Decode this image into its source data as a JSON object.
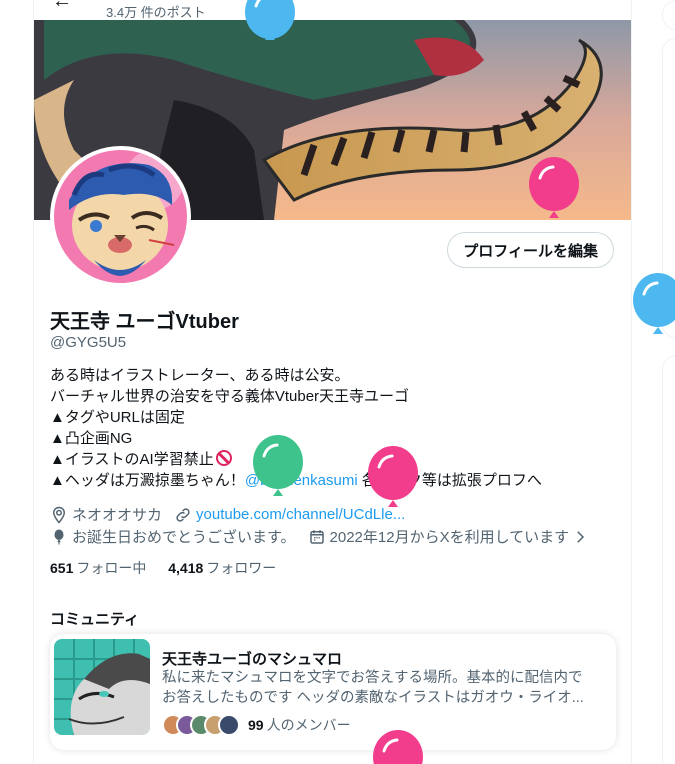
{
  "header": {
    "post_count": "3.4万 件のポスト"
  },
  "profile": {
    "edit_button": "プロフィールを編集",
    "display_name": "天王寺 ユーゴVtuber",
    "handle": "@GYG5U5",
    "bio_lines": [
      "ある時はイラストレーター、ある時は公安。",
      "バーチャル世界の治安を守る義体Vtuber天王寺ユーゴ",
      "▲タグやURLは固定",
      "▲凸企画NG",
      "▲イラストのAI学習禁止"
    ],
    "bio_last_prefix": "▲ヘッダは万澱掠墨ちゃん！",
    "bio_mention": "@bandenkasumi",
    "bio_last_suffix": " 各リンク等は拡張プロフへ",
    "location": "ネオオオサカ",
    "url": "youtube.com/channel/UCdLle...",
    "birthday": "お誕生日おめでとうございます。",
    "joined": "2022年12月からXを利用しています",
    "following_count": "651",
    "following_label": "フォロー中",
    "followers_count": "4,418",
    "followers_label": "フォロワー"
  },
  "community": {
    "section_title": "コミュニティ",
    "name": "天王寺ユーゴのマシュマロ",
    "desc_line1": "私に来たマシュマロを文字でお答えする場所。基本的に配信内で",
    "desc_line2": "お答えしたものです ヘッダの素敵なイラストはガオウ・ライオ...",
    "member_count": "99",
    "member_label": "人のメンバー"
  },
  "colors": {
    "accent": "#1d9bf0",
    "text": "#0f1419",
    "secondary": "#536471",
    "balloon_blue": "#4db8ef",
    "balloon_pink": "#f23d8d",
    "balloon_green": "#3ec38d"
  },
  "icons": {
    "location": "location-pin-icon",
    "link": "link-icon",
    "birthday": "balloon-icon",
    "calendar": "calendar-icon",
    "chevron": "chevron-right-icon"
  }
}
